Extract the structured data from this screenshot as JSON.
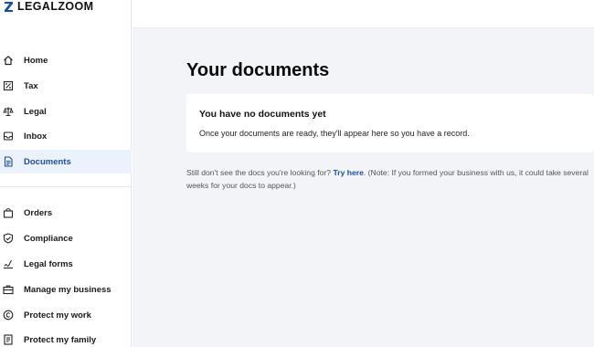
{
  "brand": {
    "name": "LEGALZOOM",
    "accent": "#1b4f9c"
  },
  "sidebar": {
    "primary": [
      {
        "label": "Home",
        "icon": "home-icon"
      },
      {
        "label": "Tax",
        "icon": "tax-icon"
      },
      {
        "label": "Legal",
        "icon": "scales-icon"
      },
      {
        "label": "Inbox",
        "icon": "inbox-icon"
      },
      {
        "label": "Documents",
        "icon": "document-icon",
        "active": true
      }
    ],
    "secondary": [
      {
        "label": "Orders",
        "icon": "bag-icon"
      },
      {
        "label": "Compliance",
        "icon": "shield-check-icon"
      },
      {
        "label": "Legal forms",
        "icon": "signature-icon"
      },
      {
        "label": "Manage my business",
        "icon": "briefcase-icon"
      },
      {
        "label": "Protect my work",
        "icon": "copyright-icon"
      },
      {
        "label": "Protect my family",
        "icon": "family-doc-icon"
      }
    ]
  },
  "main": {
    "title": "Your documents",
    "empty_card": {
      "title": "You have no documents yet",
      "body": "Once your documents are ready, they'll appear here so you have a record."
    },
    "note": {
      "prefix": "Still don't see the docs you're looking for?",
      "link": "Try here",
      "suffix": ". (Note: If you formed your business with us, it could take several weeks for your docs to appear.)"
    }
  }
}
